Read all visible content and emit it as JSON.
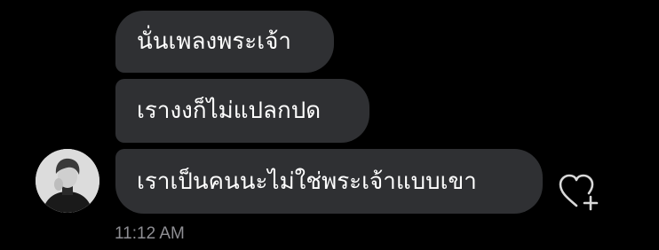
{
  "messages": [
    {
      "text": "นั่นเพลงพระเจ้า"
    },
    {
      "text": "เรางงก็ไม่แปลกปด"
    },
    {
      "text": "เราเป็นคนนะไม่ใช่พระเจ้าแบบเขา"
    }
  ],
  "timestamp": "11:12 AM",
  "icons": {
    "avatar": "avatar",
    "reaction": "heart-plus-icon"
  },
  "colors": {
    "background": "#000000",
    "bubble": "#2f3033",
    "text": "#ffffff",
    "timestamp": "#8e8e93"
  }
}
